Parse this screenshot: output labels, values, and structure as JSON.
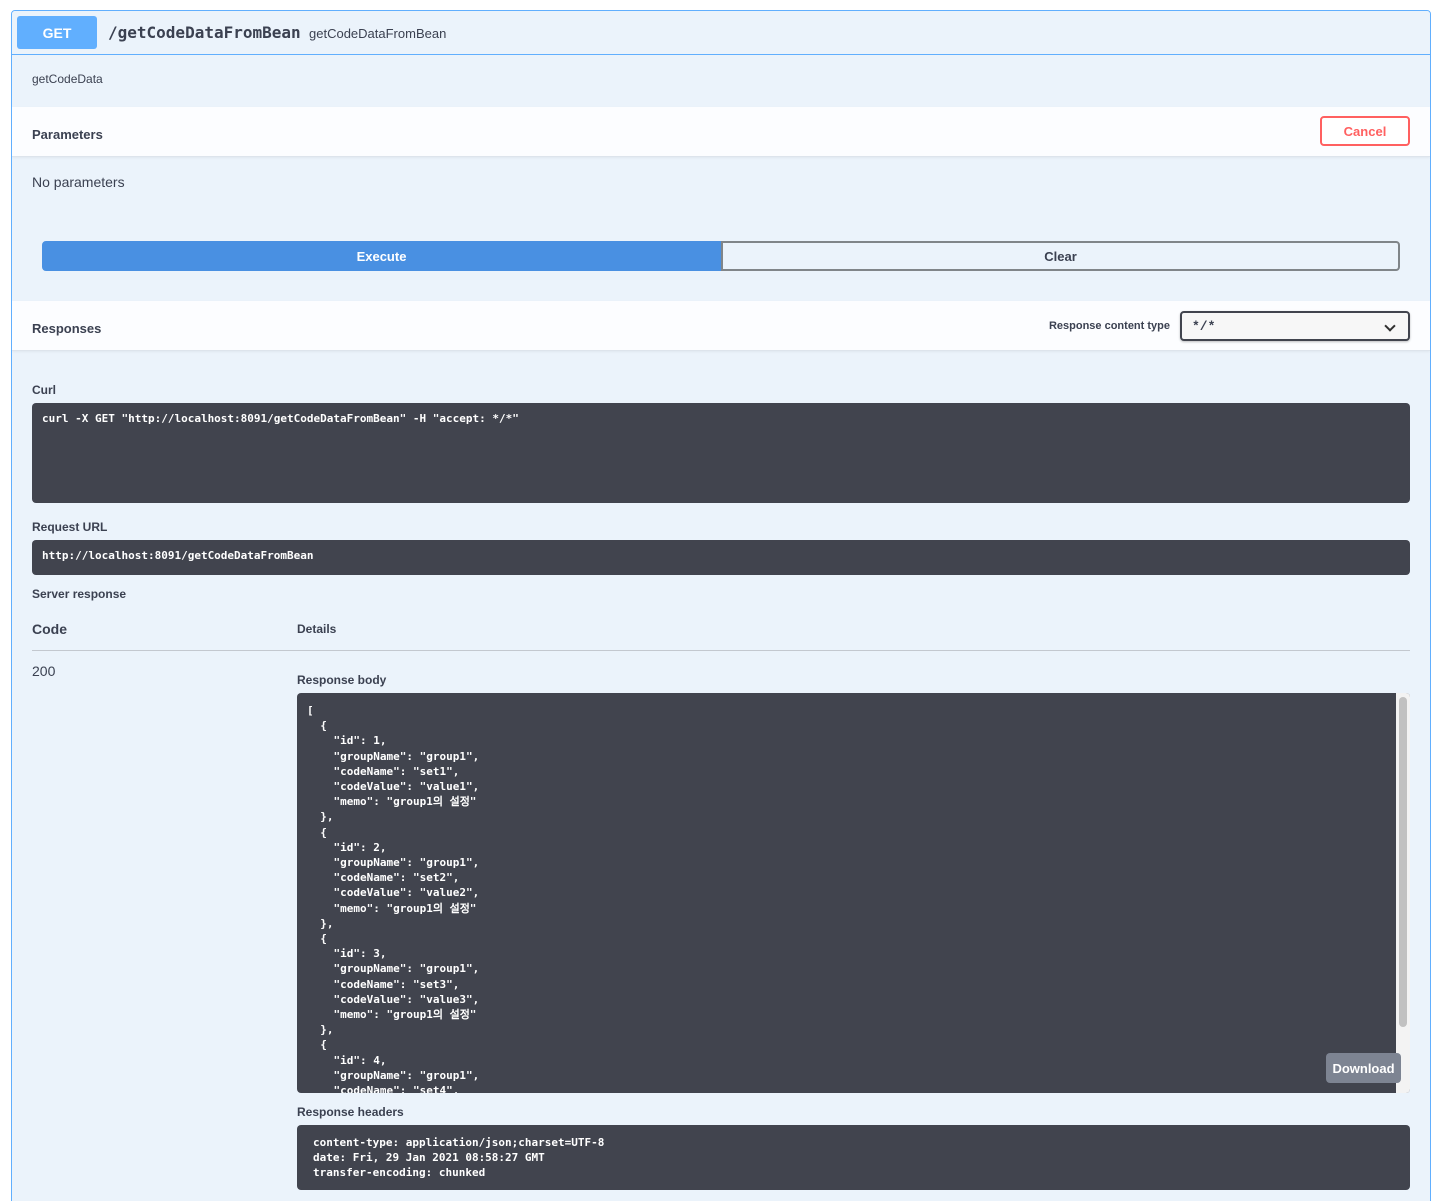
{
  "operation": {
    "method": "GET",
    "path": "/getCodeDataFromBean",
    "summary": "getCodeDataFromBean",
    "description": "getCodeData"
  },
  "parameters": {
    "title": "Parameters",
    "cancel_label": "Cancel",
    "empty_text": "No parameters"
  },
  "actions": {
    "execute_label": "Execute",
    "clear_label": "Clear"
  },
  "responses": {
    "title": "Responses",
    "content_type_label": "Response content type",
    "content_type_value": "*/*"
  },
  "curl": {
    "label": "Curl",
    "command": "curl -X GET \"http://localhost:8091/getCodeDataFromBean\" -H \"accept: */*\""
  },
  "request_url": {
    "label": "Request URL",
    "value": "http://localhost:8091/getCodeDataFromBean"
  },
  "server_response": {
    "label": "Server response",
    "code_header": "Code",
    "details_header": "Details",
    "code": "200",
    "body_label": "Response body",
    "body": "[\n  {\n    \"id\": 1,\n    \"groupName\": \"group1\",\n    \"codeName\": \"set1\",\n    \"codeValue\": \"value1\",\n    \"memo\": \"group1의 설정\"\n  },\n  {\n    \"id\": 2,\n    \"groupName\": \"group1\",\n    \"codeName\": \"set2\",\n    \"codeValue\": \"value2\",\n    \"memo\": \"group1의 설정\"\n  },\n  {\n    \"id\": 3,\n    \"groupName\": \"group1\",\n    \"codeName\": \"set3\",\n    \"codeValue\": \"value3\",\n    \"memo\": \"group1의 설정\"\n  },\n  {\n    \"id\": 4,\n    \"groupName\": \"group1\",\n    \"codeName\": \"set4\",",
    "download_label": "Download",
    "headers_label": "Response headers",
    "headers": "content-type: application/json;charset=UTF-8\ndate: Fri, 29 Jan 2021 08:58:27 GMT\ntransfer-encoding: chunked"
  },
  "colors": {
    "get_method": "#61affe",
    "execute": "#4990e2",
    "cancel": "#ff6060",
    "code_bg": "#41444e"
  }
}
